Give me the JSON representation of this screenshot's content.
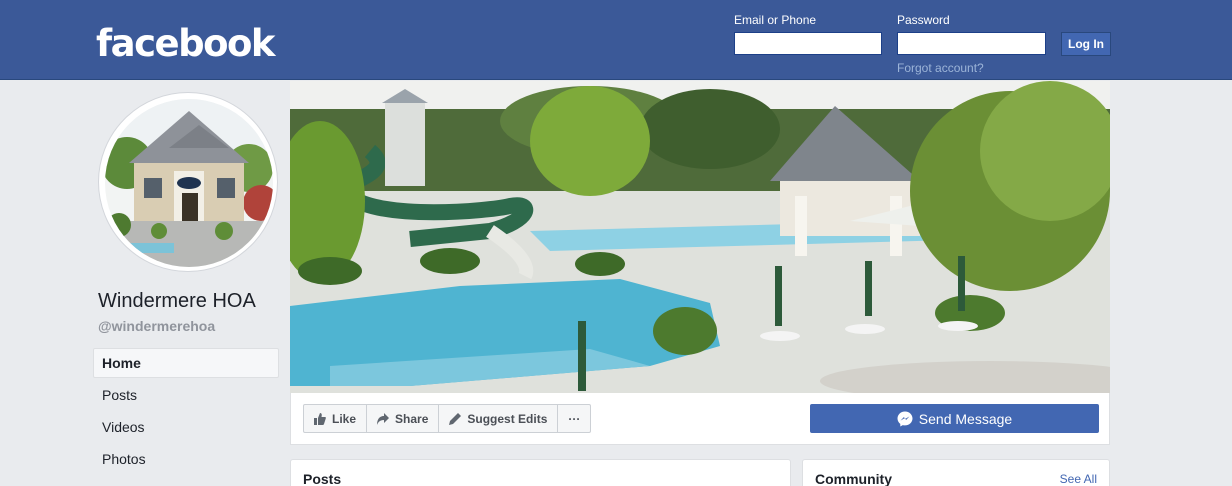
{
  "header": {
    "logo": "facebook",
    "email_label": "Email or Phone",
    "password_label": "Password",
    "login_button": "Log In",
    "forgot_link": "Forgot account?"
  },
  "page": {
    "name": "Windermere HOA",
    "handle": "@windermerehoa"
  },
  "nav": {
    "items": [
      {
        "label": "Home",
        "active": true
      },
      {
        "label": "Posts",
        "active": false
      },
      {
        "label": "Videos",
        "active": false
      },
      {
        "label": "Photos",
        "active": false
      }
    ]
  },
  "actions": {
    "like": "Like",
    "share": "Share",
    "suggest": "Suggest Edits",
    "more": "···",
    "send_message": "Send Message"
  },
  "cards": {
    "posts_title": "Posts",
    "community_title": "Community",
    "see_all": "See All"
  },
  "colors": {
    "brand_blue": "#3b5998",
    "button_blue": "#4267b2",
    "background": "#e9ebee"
  }
}
